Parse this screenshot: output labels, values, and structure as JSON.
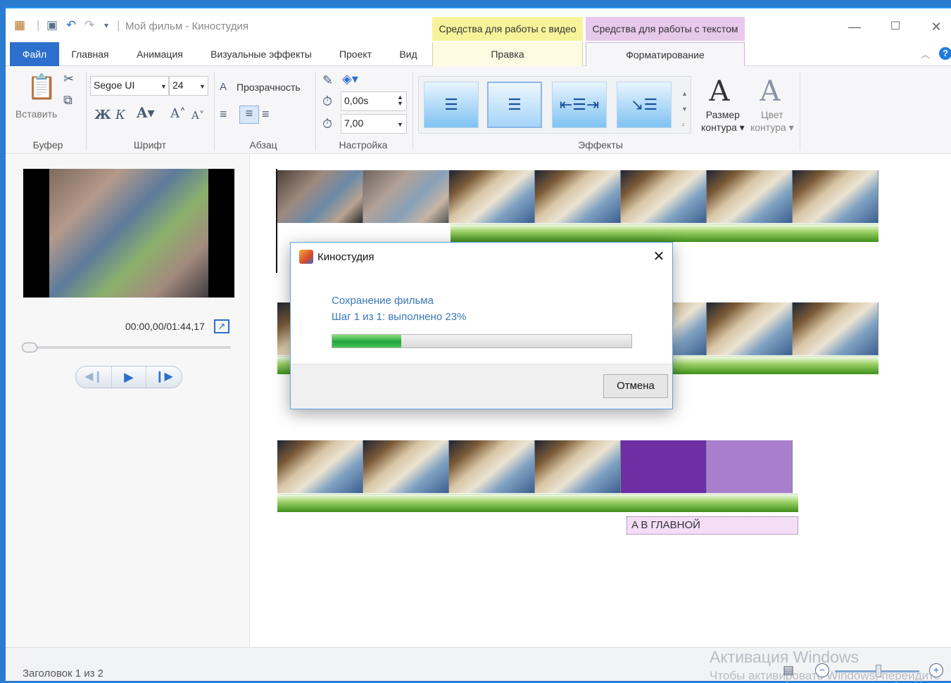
{
  "window": {
    "title": "Мой фильм - Киностудия",
    "context_tabs": [
      "Средства для работы с видео",
      "Средства для работы с текстом"
    ]
  },
  "tabs": {
    "file": "Файл",
    "home": "Главная",
    "animation": "Анимация",
    "visual_effects": "Визуальные эффекты",
    "project": "Проект",
    "view": "Вид",
    "edit": "Правка",
    "format": "Форматирование"
  },
  "ribbon": {
    "clipboard": {
      "paste_label": "Вставить",
      "group": "Буфер"
    },
    "font": {
      "family": "Segoe UI",
      "size": "24",
      "group": "Шрифт"
    },
    "paragraph": {
      "transparency": "Прозрачность",
      "group": "Абзац"
    },
    "adjust": {
      "start_time": "0,00s",
      "duration": "7,00",
      "group": "Настройка"
    },
    "effects": {
      "group": "Эффекты",
      "outline_size": [
        "Размер",
        "контура"
      ],
      "outline_color": [
        "Цвет",
        "контура"
      ]
    }
  },
  "preview": {
    "timecode": "00:00,00/01:44,17",
    "seek_position": 0.0
  },
  "storyboard": {
    "caption": "A В ГЛАВНОЙ"
  },
  "status": {
    "text": "Заголовок 1 из 2",
    "watermark_title": "Активация Windows",
    "watermark_sub": "Чтобы активировать Windows, перейдите"
  },
  "dialog": {
    "title": "Киностудия",
    "heading": "Сохранение фильма",
    "step": "Шаг 1 из 1: выполнено 23%",
    "progress": 0.23,
    "cancel_label": "Отмена"
  },
  "colors": {
    "accent": "#2c6fcc",
    "progress": "#1fa63a",
    "video_tools": "#f7f39a",
    "text_tools": "#e8c9ec"
  },
  "icons": [
    "film-icon",
    "save-icon",
    "undo-icon",
    "redo-icon",
    "cut-icon",
    "copy-icon",
    "paste-icon",
    "help-icon",
    "fullscreen-icon",
    "play-icon",
    "prev-frame-icon",
    "next-frame-icon",
    "zoom-in-icon",
    "zoom-out-icon"
  ]
}
